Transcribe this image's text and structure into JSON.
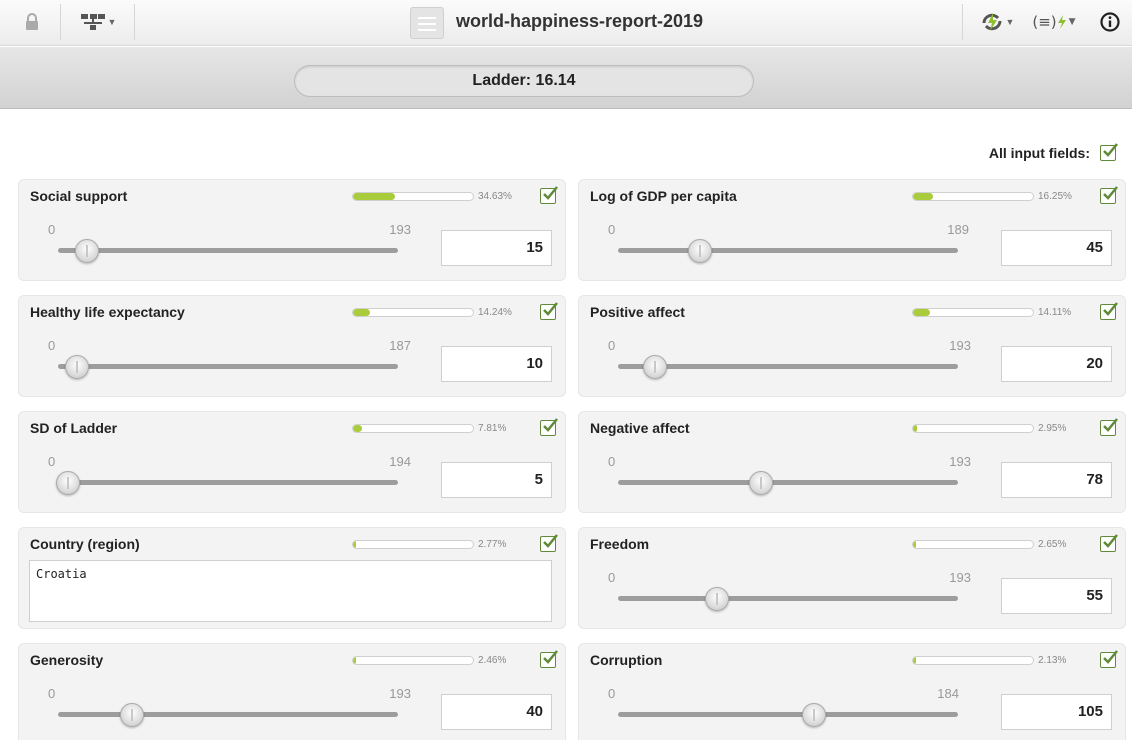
{
  "app": {
    "title": "world-happiness-report-2019",
    "icons": [
      "lock-icon",
      "model-tree-icon",
      "document-icon",
      "refresh-lightning-icon",
      "input-fields-lightning-icon",
      "info-icon"
    ]
  },
  "prediction": {
    "label": "Ladder: 16.14"
  },
  "all_fields": {
    "label": "All input fields:",
    "checked": true
  },
  "colors": {
    "accent": "#a8cc3c",
    "checkbox": "#5f8a36"
  },
  "fields": [
    {
      "name": "Social support",
      "importance": "34.63%",
      "min": "0",
      "max": "193",
      "value": "15"
    },
    {
      "name": "Log of GDP per capita",
      "importance": "16.25%",
      "min": "0",
      "max": "189",
      "value": "45"
    },
    {
      "name": "Healthy life expectancy",
      "importance": "14.24%",
      "min": "0",
      "max": "187",
      "value": "10"
    },
    {
      "name": "Positive affect",
      "importance": "14.11%",
      "min": "0",
      "max": "193",
      "value": "20"
    },
    {
      "name": "SD of Ladder",
      "importance": "7.81%",
      "min": "0",
      "max": "194",
      "value": "5"
    },
    {
      "name": "Negative affect",
      "importance": "2.95%",
      "min": "0",
      "max": "193",
      "value": "78"
    },
    {
      "name": "Country (region)",
      "importance": "2.77%",
      "text": "Croatia"
    },
    {
      "name": "Freedom",
      "importance": "2.65%",
      "min": "0",
      "max": "193",
      "value": "55"
    },
    {
      "name": "Generosity",
      "importance": "2.46%",
      "min": "0",
      "max": "193",
      "value": "40"
    },
    {
      "name": "Corruption",
      "importance": "2.13%",
      "min": "0",
      "max": "184",
      "value": "105"
    }
  ]
}
